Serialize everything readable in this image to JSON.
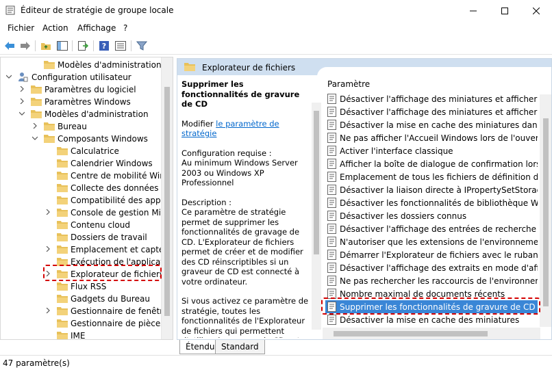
{
  "window": {
    "title": "Éditeur de stratégie de groupe locale"
  },
  "menu": [
    "Fichier",
    "Action",
    "Affichage",
    "?"
  ],
  "tree": [
    {
      "label": "Modèles d'administration",
      "indent": 3,
      "arrow": "",
      "icon": "folder"
    },
    {
      "label": "Configuration utilisateur",
      "indent": 1,
      "arrow": "down",
      "icon": "user"
    },
    {
      "label": "Paramètres du logiciel",
      "indent": 2,
      "arrow": "right",
      "icon": "folder"
    },
    {
      "label": "Paramètres Windows",
      "indent": 2,
      "arrow": "right",
      "icon": "folder"
    },
    {
      "label": "Modèles d'administration",
      "indent": 2,
      "arrow": "down",
      "icon": "folder"
    },
    {
      "label": "Bureau",
      "indent": 3,
      "arrow": "right",
      "icon": "folder"
    },
    {
      "label": "Composants Windows",
      "indent": 3,
      "arrow": "down",
      "icon": "folder"
    },
    {
      "label": "Calculatrice",
      "indent": 4,
      "arrow": "",
      "icon": "folder"
    },
    {
      "label": "Calendrier Windows",
      "indent": 4,
      "arrow": "",
      "icon": "folder"
    },
    {
      "label": "Centre de mobilité Windows",
      "indent": 4,
      "arrow": "",
      "icon": "folder"
    },
    {
      "label": "Collecte des données et versions préliminaires",
      "indent": 4,
      "arrow": "",
      "icon": "folder"
    },
    {
      "label": "Compatibilité des applications",
      "indent": 4,
      "arrow": "",
      "icon": "folder"
    },
    {
      "label": "Console de gestion Microsoft",
      "indent": 4,
      "arrow": "right",
      "icon": "folder"
    },
    {
      "label": "Contenu cloud",
      "indent": 4,
      "arrow": "",
      "icon": "folder"
    },
    {
      "label": "Dossiers de travail",
      "indent": 4,
      "arrow": "",
      "icon": "folder"
    },
    {
      "label": "Emplacement et capteurs",
      "indent": 4,
      "arrow": "right",
      "icon": "folder"
    },
    {
      "label": "Exécution de l'application",
      "indent": 4,
      "arrow": "",
      "icon": "folder"
    },
    {
      "label": "Explorateur de fichiers",
      "indent": 4,
      "arrow": "right",
      "icon": "folder"
    },
    {
      "label": "Flux RSS",
      "indent": 4,
      "arrow": "",
      "icon": "folder"
    },
    {
      "label": "Gadgets du Bureau",
      "indent": 4,
      "arrow": "",
      "icon": "folder"
    },
    {
      "label": "Gestionnaire de fenêtres du Bureau",
      "indent": 4,
      "arrow": "right",
      "icon": "folder"
    },
    {
      "label": "Gestionnaire de pièces jointes",
      "indent": 4,
      "arrow": "",
      "icon": "folder"
    },
    {
      "label": "IME",
      "indent": 4,
      "arrow": "",
      "icon": "folder"
    }
  ],
  "right": {
    "header_title": "Explorateur de fichiers",
    "desc": {
      "title": "Supprimer les fonctionnalités de gravure de CD",
      "modify_prefix": "Modifier ",
      "modify_link": "le paramètre de stratégie",
      "requirements_label": "Configuration requise :",
      "requirements": "Au minimum Windows Server 2003 ou Windows XP Professionnel",
      "description_label": "Description :",
      "description": "Ce paramètre de stratégie permet de supprimer les fonctionnalités de gravage de CD. L'Explorateur de fichiers permet de créer et de modifier des CD réinscriptibles si un graveur de CD est connecté à votre ordinateur.",
      "description2": "Si vous activez ce paramètre de stratégie, toutes les fonctionnalités de l'Explorateur de fichiers qui permettent d'utiliser le graveur de CD ont supprimées."
    },
    "list_header": "Paramètre",
    "settings": [
      "Désactiver l'affichage des miniatures et afficher seulement les icônes",
      "Désactiver l'affichage des miniatures et afficher seulement les icônes sur les dossiers réseau",
      "Désactiver la mise en cache des miniatures dans les fichiers thumbs.db cachés",
      "Ne pas afficher l'Accueil Windows lors de l'ouverture de session",
      "Activer l'interface classique",
      "Afficher la boîte de dialogue de confirmation lors de la suppression de fichiers",
      "Emplacement de tous les fichiers de définition de bibliothèque",
      "Désactiver la liaison directe à IPropertySetStorage sans conversion",
      "Désactiver les fonctionnalités de bibliothèque Windows",
      "Désactiver les dossiers connus",
      "Désactiver l'affichage des entrées de recherche récentes",
      "N'autoriser que les extensions de l'environnement par utilisateur",
      "Démarrer l'Explorateur de fichiers avec le ruban réduit",
      "Désactiver l'affichage des extraits en mode d'affichage Contenu",
      "Ne pas rechercher les raccourcis de l'environnement lors de la résolution",
      "Nombre maximal de documents récents",
      "Supprimer les fonctionnalités de gravure de CD",
      "Désactiver la mise en cache des miniatures"
    ],
    "selected_index": 16
  },
  "tabs": [
    "Étendu",
    "Standard"
  ],
  "status": "47 paramètre(s)",
  "colors": {
    "selection": "#3a86d6",
    "header_bg": "#cfdff0",
    "highlight": "#d40000",
    "folder": "#e8c15a"
  }
}
